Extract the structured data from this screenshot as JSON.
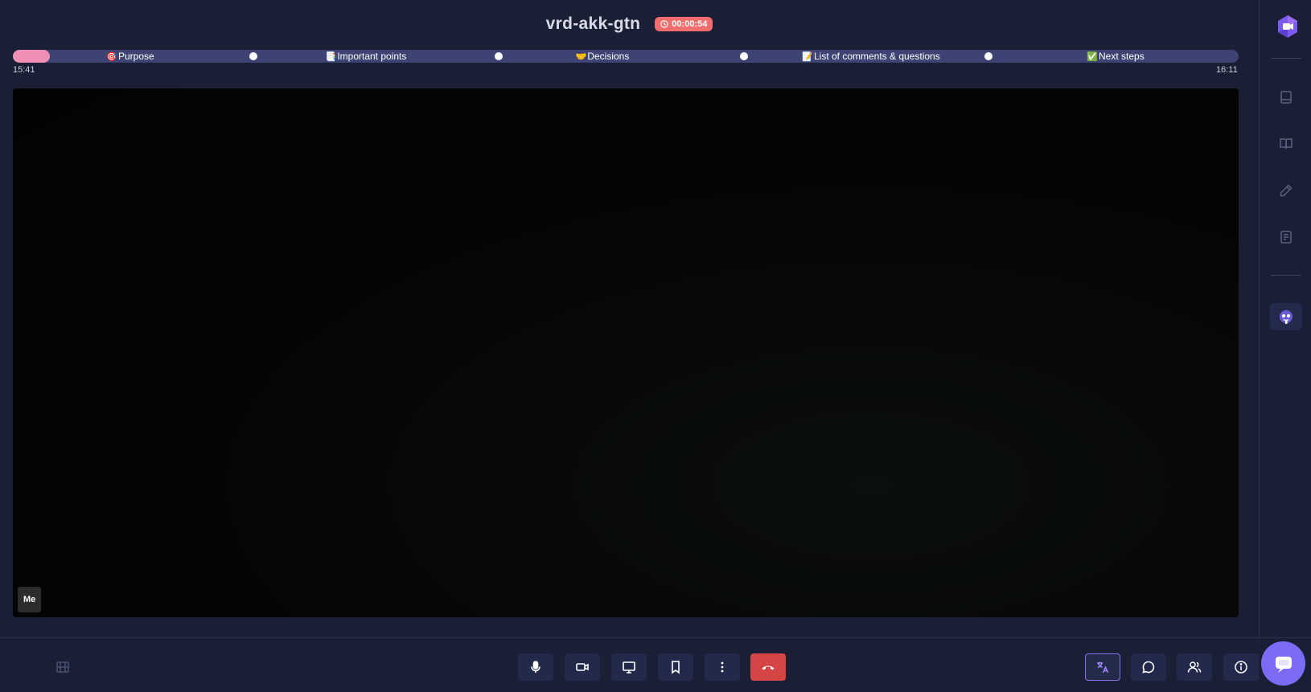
{
  "header": {
    "meeting_title": "vrd-akk-gtn",
    "timer": "00:00:54"
  },
  "agenda": {
    "start_time": "15:41",
    "end_time": "16:11",
    "progress": 0.03,
    "items": [
      {
        "emoji": "🎯",
        "label": "Purpose"
      },
      {
        "emoji": "📑",
        "label": "Important points"
      },
      {
        "emoji": "🤝",
        "label": "Decisions"
      },
      {
        "emoji": "📝",
        "label": "List of comments & questions"
      },
      {
        "emoji": "✅",
        "label": "Next steps"
      }
    ]
  },
  "video": {
    "participant_label": "Me"
  },
  "rail": {
    "icons": [
      "app-logo-icon",
      "notes-icon",
      "book-icon",
      "pencil-icon",
      "document-icon",
      "robot-icon"
    ]
  },
  "controls": {
    "left": [
      "layout-icon"
    ],
    "center": [
      "microphone-icon",
      "camera-icon",
      "screen-share-icon",
      "bookmark-icon",
      "more-options-icon",
      "end-call-icon"
    ],
    "right": [
      "translate-icon",
      "chat-icon",
      "participants-icon",
      "info-icon"
    ]
  },
  "colors": {
    "background": "#1a1f35",
    "agenda_track": "#3d4473",
    "agenda_progress": "#f08fb5",
    "timer_badge": "#f26d6d",
    "end_call": "#d64545",
    "accent": "#7c6cf5"
  }
}
